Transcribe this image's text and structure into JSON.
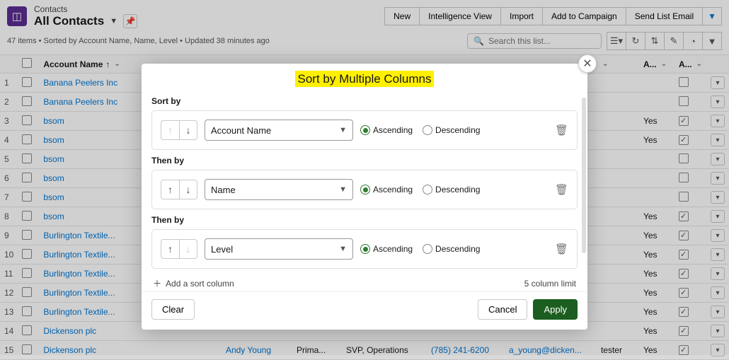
{
  "header": {
    "object": "Contacts",
    "listview": "All Contacts",
    "buttons": [
      "New",
      "Intelligence View",
      "Import",
      "Add to Campaign",
      "Send List Email"
    ],
    "status": "47 items • Sorted by Account Name, Name, Level • Updated 38 minutes ago",
    "search_placeholder": "Search this list..."
  },
  "columns": {
    "account": "Account Name",
    "col_a1": "A...",
    "col_a2": "A..."
  },
  "rows": [
    {
      "n": "1",
      "acct": "Banana Peelers Inc"
    },
    {
      "n": "2",
      "acct": "Banana Peelers Inc"
    },
    {
      "n": "3",
      "acct": "bsom",
      "yes": "Yes",
      "ck": true
    },
    {
      "n": "4",
      "acct": "bsom",
      "yes": "Yes",
      "ck": true
    },
    {
      "n": "5",
      "acct": "bsom"
    },
    {
      "n": "6",
      "acct": "bsom"
    },
    {
      "n": "7",
      "acct": "bsom"
    },
    {
      "n": "8",
      "acct": "bsom",
      "yes": "Yes",
      "ck": true
    },
    {
      "n": "9",
      "acct": "Burlington Textile...",
      "yes": "Yes",
      "ck": true
    },
    {
      "n": "10",
      "acct": "Burlington Textile...",
      "yes": "Yes",
      "ck": true
    },
    {
      "n": "11",
      "acct": "Burlington Textile...",
      "yes": "Yes",
      "ck": true
    },
    {
      "n": "12",
      "acct": "Burlington Textile...",
      "yes": "Yes",
      "ck": true
    },
    {
      "n": "13",
      "acct": "Burlington Textile...",
      "yes": "Yes",
      "ck": true
    },
    {
      "n": "14",
      "acct": "Dickenson plc",
      "yes": "Yes",
      "ck": true
    },
    {
      "n": "15",
      "acct": "Dickenson plc",
      "name": "Andy Young",
      "c3": "Prima...",
      "c4": "SVP, Operations",
      "phone": "(785) 241-6200",
      "email": "a_young@dicken...",
      "c7": "tester",
      "yes": "Yes",
      "ck": true
    }
  ],
  "modal": {
    "title": "Sort by Multiple Columns",
    "labels": {
      "sortby": "Sort by",
      "thenby": "Then by",
      "asc": "Ascending",
      "desc": "Descending"
    },
    "rules": [
      {
        "field": "Account Name",
        "dir": "asc",
        "upDisabled": true,
        "downDisabled": false
      },
      {
        "field": "Name",
        "dir": "asc",
        "upDisabled": false,
        "downDisabled": false
      },
      {
        "field": "Level",
        "dir": "asc",
        "upDisabled": false,
        "downDisabled": true
      }
    ],
    "add": "Add a sort column",
    "limit": "5 column limit",
    "clear": "Clear",
    "cancel": "Cancel",
    "apply": "Apply"
  }
}
